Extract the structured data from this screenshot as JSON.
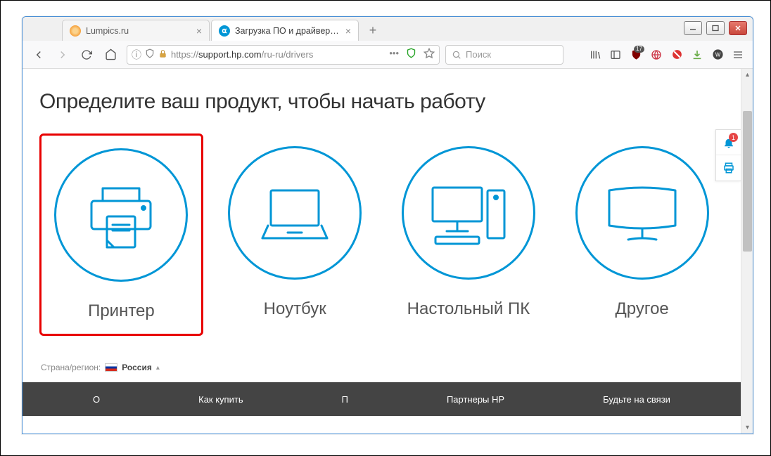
{
  "window_controls": {
    "minimize": "–",
    "maximize": "▢",
    "close": "✕"
  },
  "tabs": [
    {
      "title": "Lumpics.ru",
      "favicon_color": "#f6a13c",
      "active": false
    },
    {
      "title": "Загрузка ПО и драйверов HP",
      "favicon_color": "#0096d6",
      "active": true
    }
  ],
  "nav": {
    "url_display_prefix": "https://",
    "url_host": "support.hp.com",
    "url_path": "/ru-ru/drivers",
    "search_placeholder": "Поиск",
    "ublock_count": "17"
  },
  "page": {
    "heading": "Определите ваш продукт, чтобы начать работу",
    "products": [
      {
        "id": "printer",
        "label": "Принтер",
        "highlight": true
      },
      {
        "id": "laptop",
        "label": "Ноутбук",
        "highlight": false
      },
      {
        "id": "desktop",
        "label": "Настольный ПК",
        "highlight": false
      },
      {
        "id": "other",
        "label": "Другое",
        "highlight": false
      }
    ],
    "region_label": "Страна/регион:",
    "region_name": "Россия",
    "footer_links": [
      "О",
      "Как купить",
      "П",
      "Партнеры HP",
      "Будьте на связи"
    ],
    "notif_count": "1"
  },
  "colors": {
    "hp_blue": "#0096d6"
  }
}
